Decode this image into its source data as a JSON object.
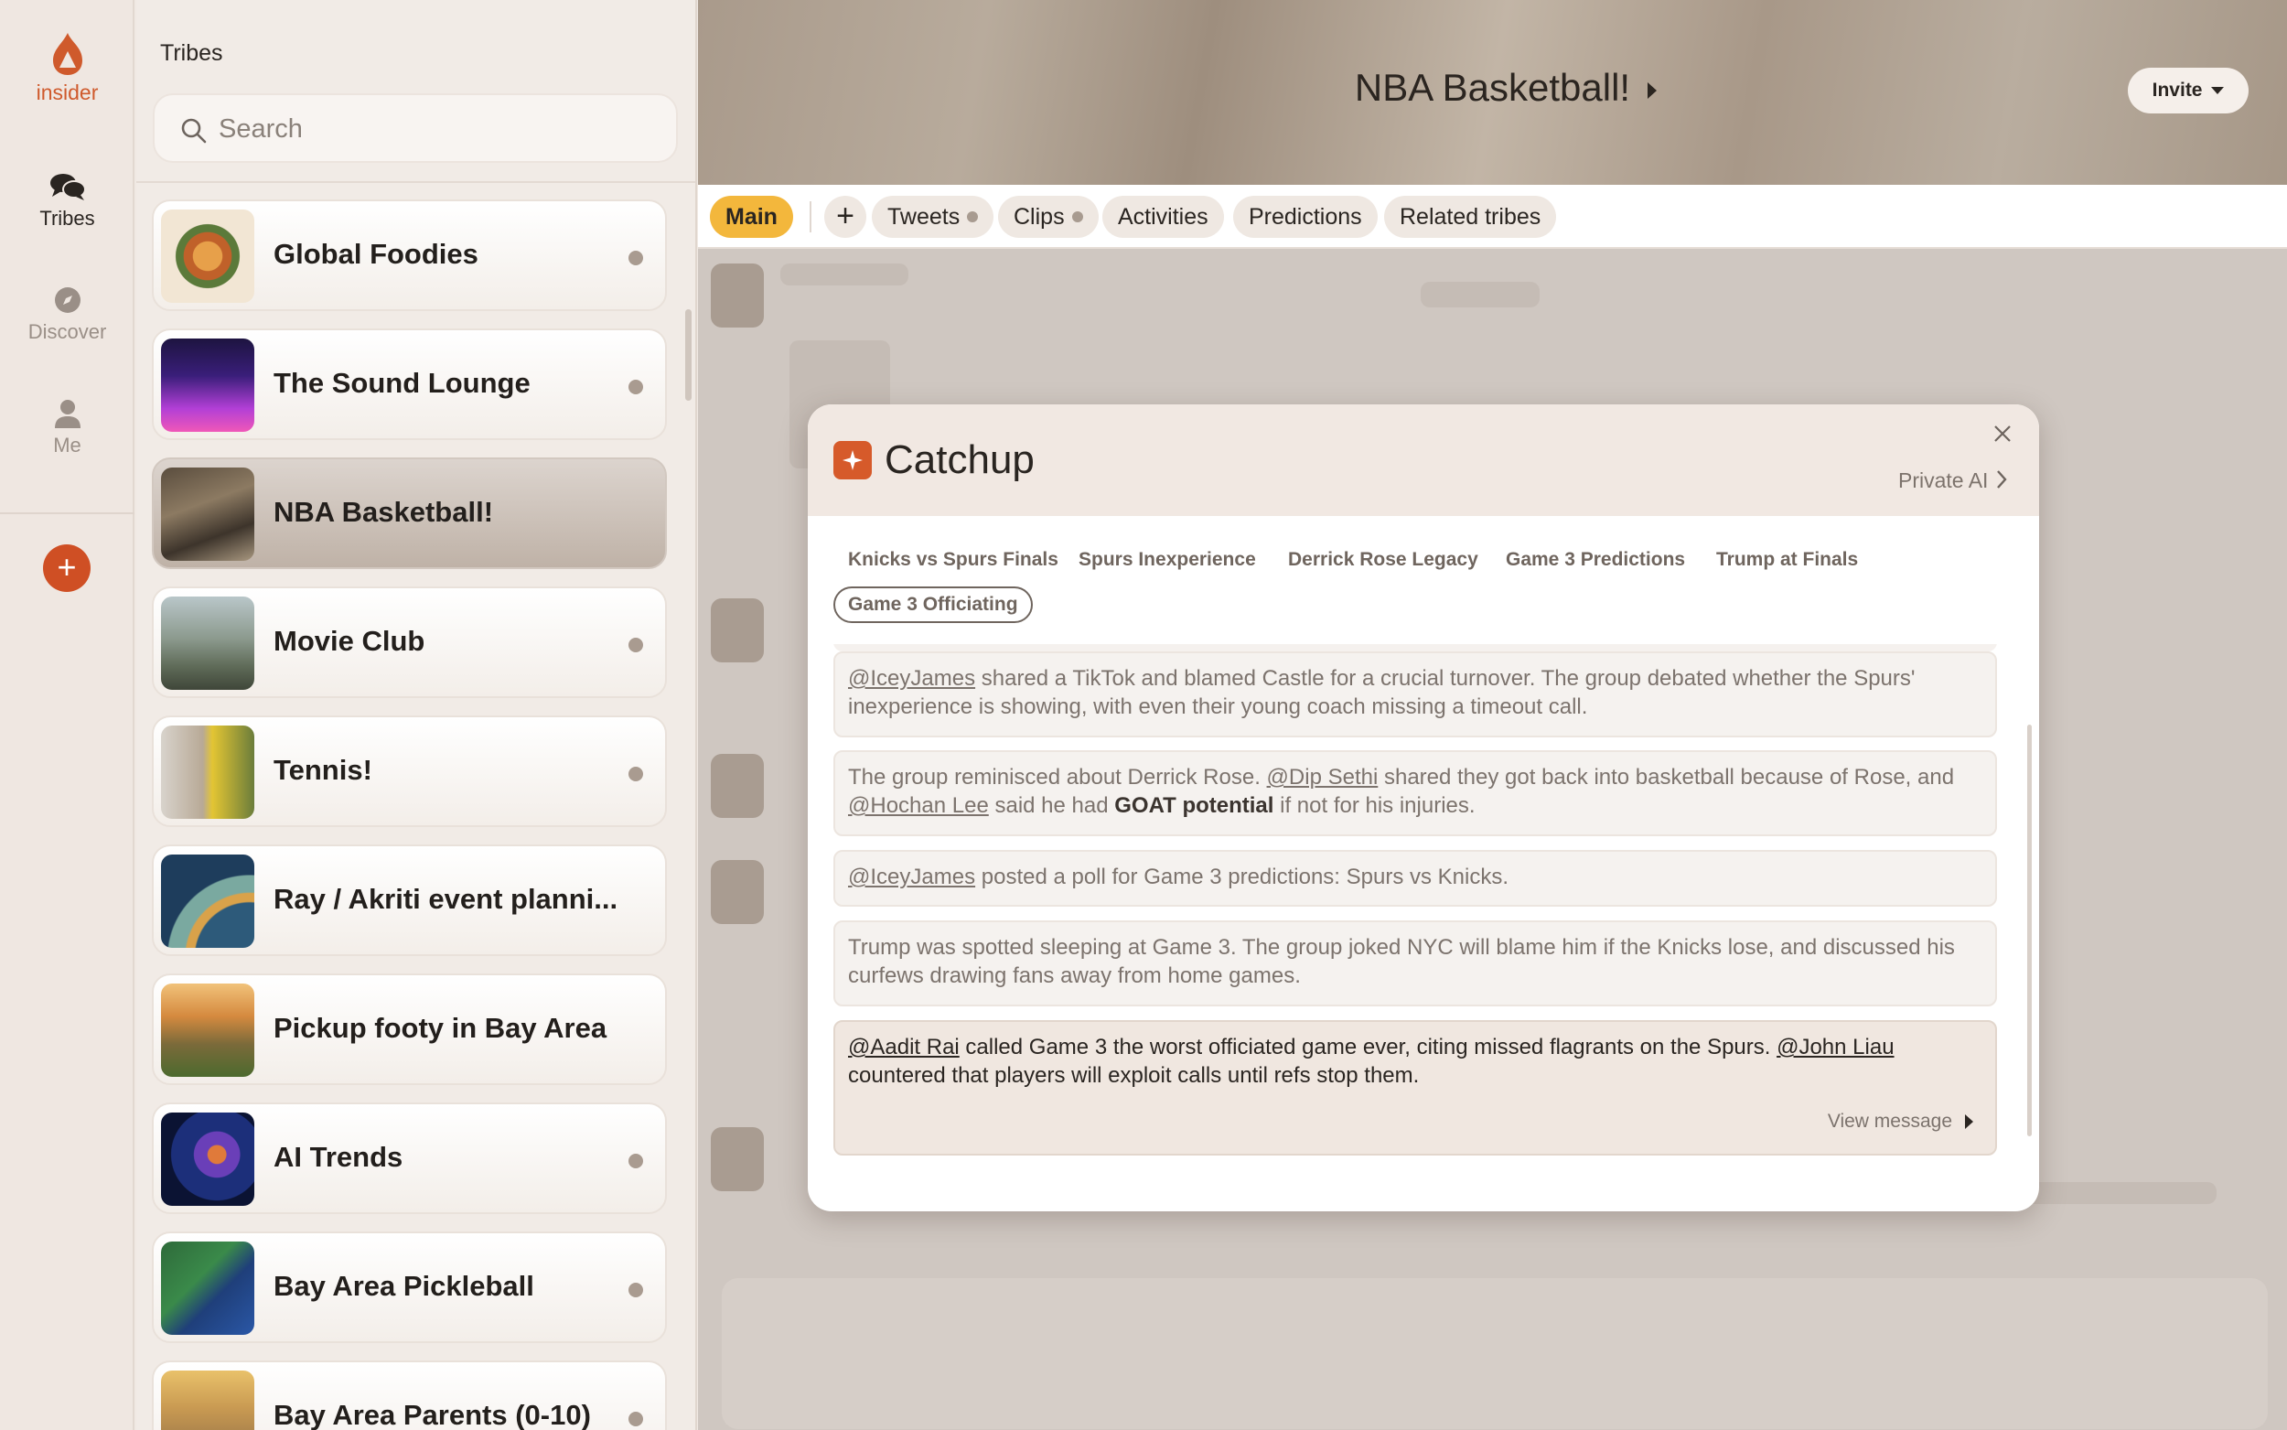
{
  "app": {
    "brand": "insider"
  },
  "rail": {
    "items": [
      {
        "label": "Tribes",
        "icon": "chat-bubbles-icon",
        "active": true
      },
      {
        "label": "Discover",
        "icon": "compass-icon",
        "active": false
      },
      {
        "label": "Me",
        "icon": "person-icon",
        "active": false
      }
    ],
    "add_icon": "plus-icon"
  },
  "tribes": {
    "title": "Tribes",
    "search_placeholder": "Search",
    "items": [
      {
        "name": "Global Foodies",
        "unread": true,
        "active": false
      },
      {
        "name": "The Sound Lounge",
        "unread": true,
        "active": false
      },
      {
        "name": "NBA Basketball!",
        "unread": false,
        "active": true
      },
      {
        "name": "Movie Club",
        "unread": true,
        "active": false
      },
      {
        "name": "Tennis!",
        "unread": true,
        "active": false
      },
      {
        "name": "Ray / Akriti event planni...",
        "unread": false,
        "active": false
      },
      {
        "name": "Pickup footy in Bay Area",
        "unread": false,
        "active": false
      },
      {
        "name": "AI Trends",
        "unread": true,
        "active": false
      },
      {
        "name": "Bay Area Pickleball",
        "unread": true,
        "active": false
      },
      {
        "name": "Bay Area Parents (0-10)",
        "unread": true,
        "active": false
      }
    ]
  },
  "channel": {
    "title": "NBA Basketball!",
    "invite_label": "Invite",
    "tabs": [
      {
        "label": "Main",
        "active": true,
        "dot": false
      },
      {
        "label": "Tweets",
        "active": false,
        "dot": true
      },
      {
        "label": "Clips",
        "active": false,
        "dot": true
      },
      {
        "label": "Activities",
        "active": false,
        "dot": false
      },
      {
        "label": "Predictions",
        "active": false,
        "dot": false
      },
      {
        "label": "Related tribes",
        "active": false,
        "dot": false
      }
    ]
  },
  "catchup": {
    "title": "Catchup",
    "private_ai_label": "Private AI",
    "topics": [
      "Knicks vs Spurs Finals",
      "Spurs Inexperience",
      "Derrick Rose Legacy",
      "Game 3 Predictions",
      "Trump at Finals",
      "Game 3 Officiating"
    ],
    "active_topic": "Game 3 Officiating",
    "entries": [
      {
        "m1": "@IceyJames",
        "t1": " shared a TikTok and blamed Castle for a crucial turnover. The group debated whether the Spurs' inexperience is showing, with even their young coach missing a timeout call."
      },
      {
        "t0": "The group reminisced about Derrick Rose. ",
        "m1": "@Dip Sethi",
        "t1": " shared they got back into basketball because of Rose, and ",
        "m2": "@Hochan Lee",
        "t2": " said he had ",
        "b": "GOAT potential",
        "t3": " if not for his injuries."
      },
      {
        "m1": "@IceyJames",
        "t1": " posted a poll for Game 3 predictions: Spurs vs Knicks."
      },
      {
        "t0": "Trump was spotted sleeping at Game 3. The group joked NYC will blame him if the Knicks lose, and discussed his curfews drawing fans away from home games."
      },
      {
        "m1": "@Aadit Rai",
        "t1": " called Game 3 the worst officiated game ever, citing missed flagrants on the Spurs. ",
        "m2": "@John Liau",
        "t2": " countered that players will exploit calls until refs stop them.",
        "view_label": "View message"
      }
    ]
  },
  "colors": {
    "accent": "#cf5a2c",
    "active_tab": "#f3b73c",
    "add_button": "#cf4f24"
  }
}
